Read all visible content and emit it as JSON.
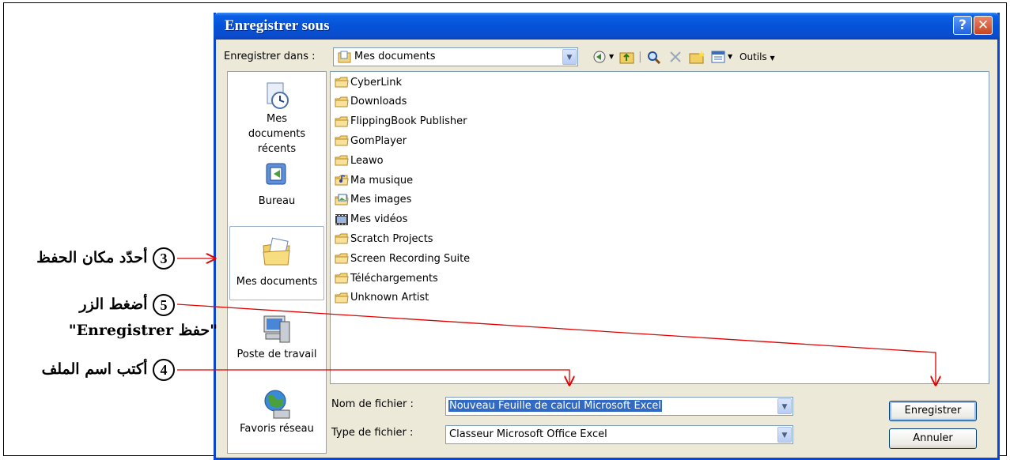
{
  "dialog": {
    "title": "Enregistrer sous",
    "help_label": "?",
    "close_label": "✕"
  },
  "toolbar": {
    "save_in_label": "Enregistrer dans :",
    "location_value": "Mes documents",
    "tools_label": "Outils"
  },
  "places": [
    {
      "label": "Mes documents récents",
      "icon": "recent-documents-icon"
    },
    {
      "label": "Bureau",
      "icon": "desktop-icon"
    },
    {
      "label": "Mes documents",
      "icon": "my-documents-icon",
      "selected": true
    },
    {
      "label": "Poste de travail",
      "icon": "my-computer-icon"
    },
    {
      "label": "Favoris réseau",
      "icon": "network-places-icon"
    }
  ],
  "files": [
    {
      "name": "CyberLink",
      "icon": "folder-icon"
    },
    {
      "name": "Downloads",
      "icon": "folder-icon"
    },
    {
      "name": "FlippingBook Publisher",
      "icon": "folder-icon"
    },
    {
      "name": "GomPlayer",
      "icon": "folder-icon"
    },
    {
      "name": "Leawo",
      "icon": "folder-icon"
    },
    {
      "name": "Ma musique",
      "icon": "music-folder-icon"
    },
    {
      "name": "Mes images",
      "icon": "pictures-folder-icon"
    },
    {
      "name": "Mes vidéos",
      "icon": "videos-folder-icon"
    },
    {
      "name": "Scratch Projects",
      "icon": "folder-icon"
    },
    {
      "name": "Screen Recording Suite",
      "icon": "folder-icon"
    },
    {
      "name": "Téléchargements",
      "icon": "folder-icon"
    },
    {
      "name": "Unknown Artist",
      "icon": "folder-icon"
    }
  ],
  "form": {
    "filename_label": "Nom de fichier :",
    "filename_value": "Nouveau Feuille de calcul Microsoft Excel",
    "filetype_label": "Type de fichier :",
    "filetype_value": "Classeur Microsoft Office Excel"
  },
  "buttons": {
    "save": "Enregistrer",
    "cancel": "Annuler"
  },
  "annotations": {
    "step3_num": "3",
    "step3_text": "أحدّد مكان الحفظ",
    "step5_num": "5",
    "step5_line1": "أضغط الزر",
    "step5_line2": "\"حفظ Enregistrer\"",
    "step4_num": "4",
    "step4_text": "أكتب اسم الملف"
  },
  "colors": {
    "titlebar": "#0553d9",
    "dialog_bg": "#ece9d8",
    "selection": "#316ac5",
    "annotation_arrow": "#e00000",
    "folder": "#f5d57a"
  }
}
